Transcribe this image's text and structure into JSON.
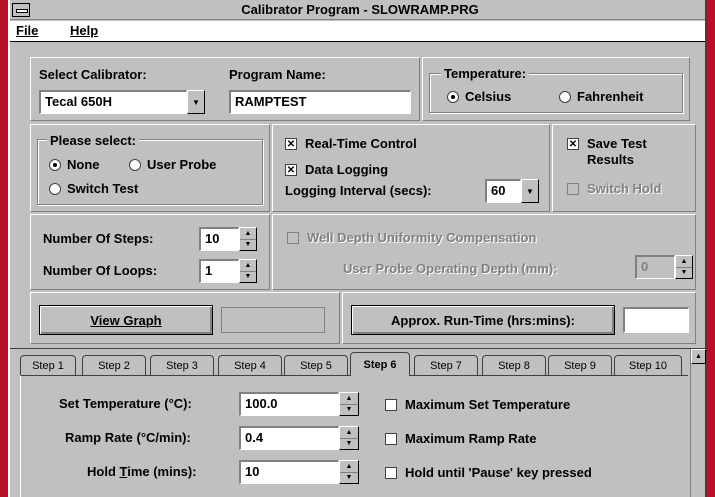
{
  "window": {
    "title": "Calibrator Program - SLOWRAMP.PRG"
  },
  "menu": {
    "file": "File",
    "help": "Help"
  },
  "calibrator": {
    "label": "Select Calibrator:",
    "value": "Tecal 650H"
  },
  "program": {
    "label": "Program Name:",
    "value": "RAMPTEST"
  },
  "temperature": {
    "label": "Temperature:",
    "celsius": "Celsius",
    "fahrenheit": "Fahrenheit",
    "selected": "Celsius"
  },
  "please_select": {
    "label": "Please select:",
    "none": "None",
    "user_probe": "User Probe",
    "switch_test": "Switch Test",
    "selected": "None"
  },
  "control": {
    "realtime": "Real-Time Control",
    "realtime_checked": true,
    "data_logging": "Data Logging",
    "data_logging_checked": true,
    "logging_interval_label": "Logging Interval (secs):",
    "logging_interval_value": "60"
  },
  "save": {
    "save_results_line1": "Save Test",
    "save_results_line2": "Results",
    "save_checked": true,
    "switch_hold": "Switch Hold",
    "switch_hold_checked": false
  },
  "steps": {
    "steps_label": "Number Of Steps:",
    "steps_value": "10",
    "loops_label": "Number Of Loops:",
    "loops_value": "1"
  },
  "well": {
    "compensation": "Well Depth Uniformity Compensation",
    "depth_label": "User Probe Operating Depth (mm):",
    "depth_value": "0"
  },
  "actions": {
    "view_graph": "View Graph",
    "approx_runtime": "Approx. Run-Time (hrs:mins):",
    "runtime_value": ""
  },
  "tabs": [
    "Step 1",
    "Step 2",
    "Step 3",
    "Step 4",
    "Step 5",
    "Step 6",
    "Step 7",
    "Step 8",
    "Step 9",
    "Step 10"
  ],
  "active_tab": "Step 6",
  "step": {
    "set_temp_label": "Set Temperature (°C):",
    "set_temp_value": "100.0",
    "ramp_rate_label": "Ramp Rate (°C/min):",
    "ramp_rate_value": "0.4",
    "hold_time_label_pre": "Hold ",
    "hold_time_label_ul": "T",
    "hold_time_label_post": "ime (mins):",
    "hold_time_value": "10",
    "max_set_temp": "Maximum Set Temperature",
    "max_ramp_rate": "Maximum Ramp Rate",
    "hold_until_pause": "Hold until 'Pause' key pressed"
  },
  "icons": {
    "system_menu": "system-menu-icon",
    "dropdown": "chevron-down-icon",
    "spin_up": "triangle-up-icon",
    "spin_down": "triangle-down-icon"
  },
  "colors": {
    "background": "#b8102a",
    "face": "#c0c0c0"
  }
}
